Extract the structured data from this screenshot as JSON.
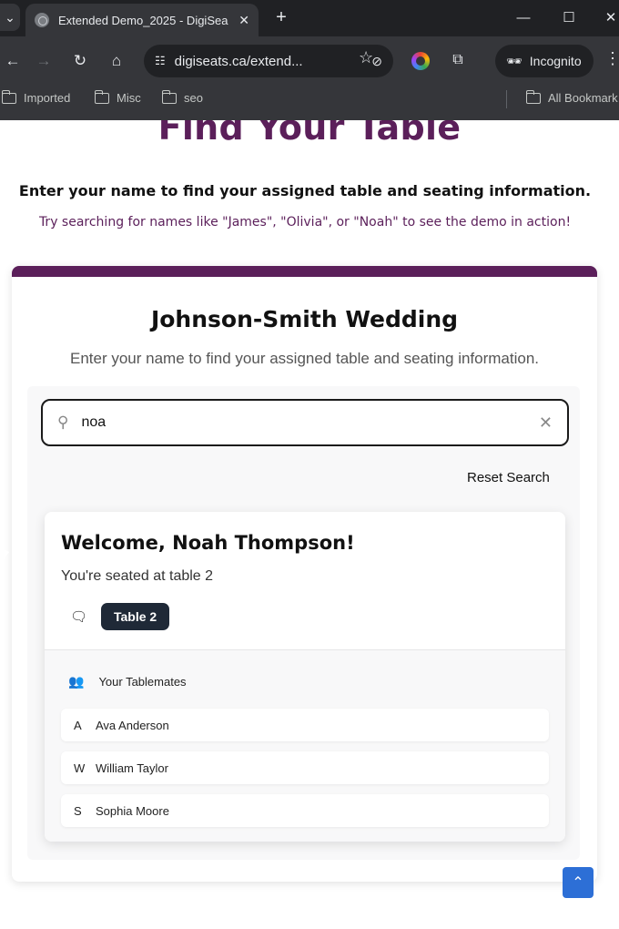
{
  "browser": {
    "tab_title": "Extended Demo_2025 - DigiSea",
    "url": "digiseats.ca/extend...",
    "incognito_label": "Incognito",
    "bookmarks": [
      "Imported",
      "Misc",
      "seo"
    ],
    "all_bookmarks": "All Bookmark"
  },
  "hero": {
    "title": "Find Your Table",
    "subtitle": "Enter your name to find your assigned table and seating information.",
    "hint": "Try searching for names like \"James\", \"Olivia\", or \"Noah\" to see the demo in action!"
  },
  "event": {
    "title": "Johnson-Smith Wedding",
    "subtitle": "Enter your name to find your assigned table and seating information."
  },
  "search": {
    "value": "noa",
    "reset_label": "Reset Search"
  },
  "result": {
    "welcome": "Welcome, Noah Thompson!",
    "seated": "You're seated at table 2",
    "table_badge": "Table 2",
    "tablemates_label": "Your Tablemates",
    "tablemates": [
      {
        "initial": "A",
        "name": "Ava Anderson"
      },
      {
        "initial": "W",
        "name": "William Taylor"
      },
      {
        "initial": "S",
        "name": "Sophia Moore"
      }
    ]
  },
  "colors": {
    "brand": "#5b1f5a",
    "badge": "#1f2937",
    "scroll_button": "#2d6fd6"
  }
}
